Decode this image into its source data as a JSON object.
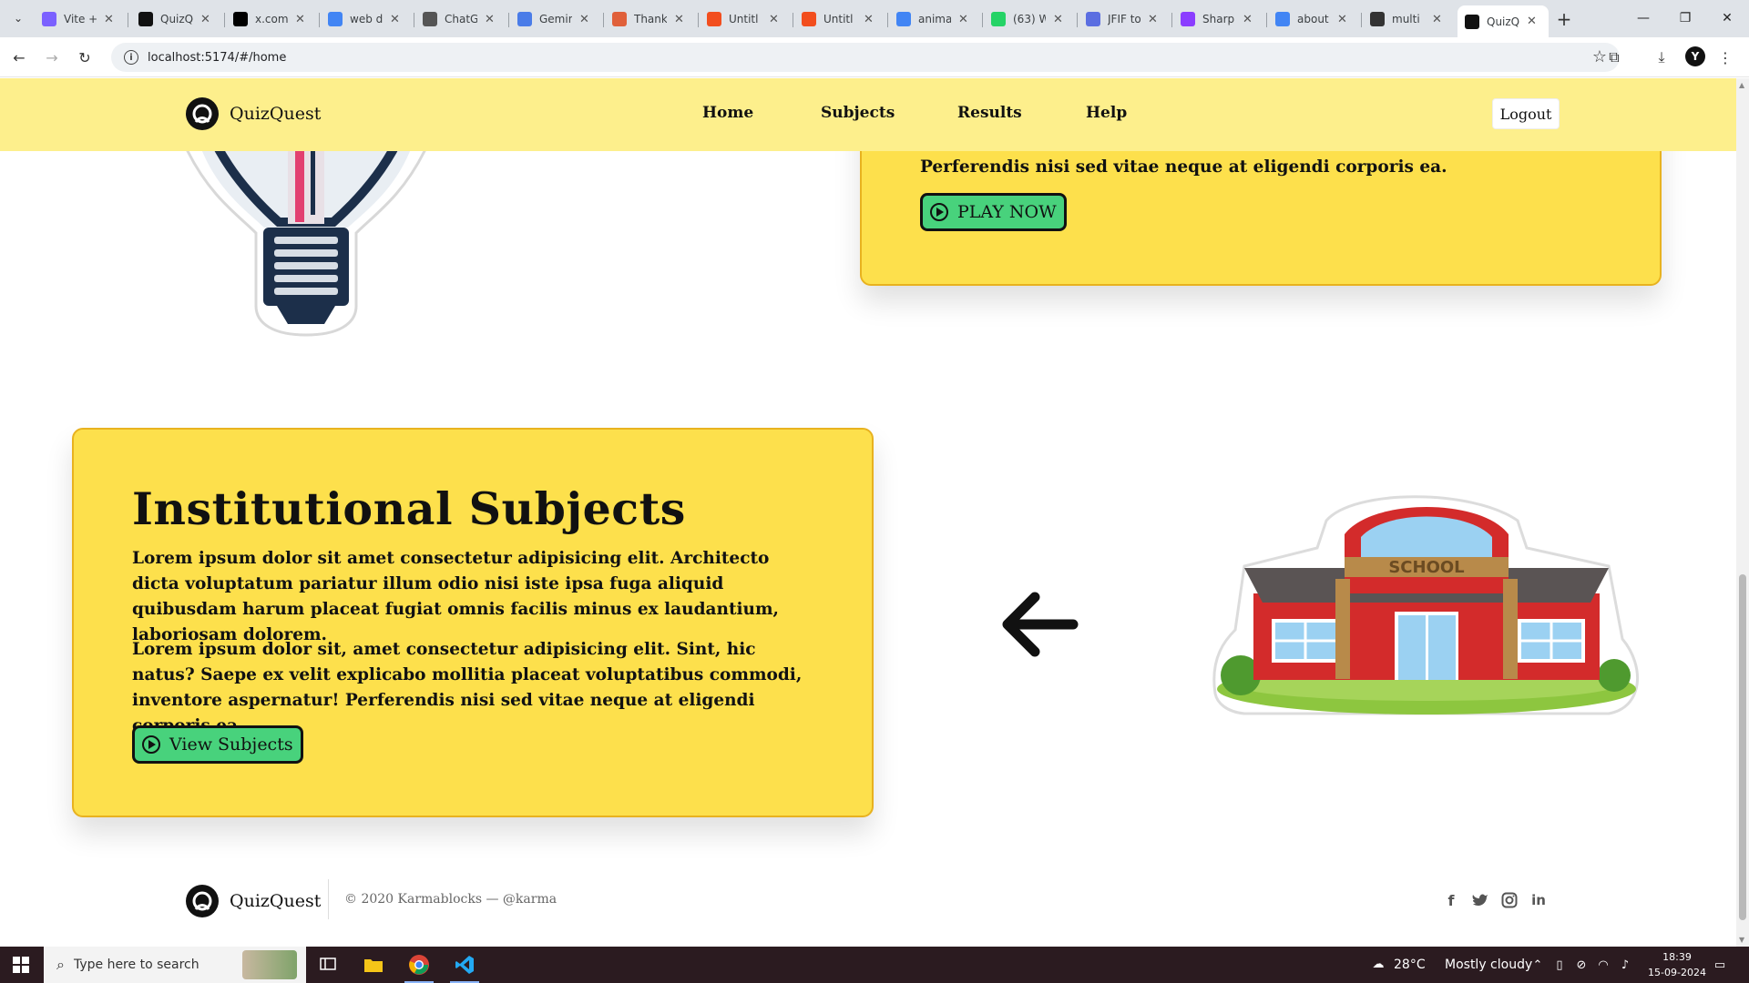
{
  "browser": {
    "tabs": [
      {
        "title": "Vite +",
        "color": "#7b61ff"
      },
      {
        "title": "QuizQ",
        "color": "#111111"
      },
      {
        "title": "x.com",
        "color": "#000000"
      },
      {
        "title": "web d",
        "color": "#4285f4"
      },
      {
        "title": "ChatG",
        "color": "#555555"
      },
      {
        "title": "Gemin",
        "color": "#4a7ce8"
      },
      {
        "title": "Thank",
        "color": "#e0603a"
      },
      {
        "title": "Untitl",
        "color": "#f24e1e"
      },
      {
        "title": "Untitl",
        "color": "#f24e1e"
      },
      {
        "title": "anima",
        "color": "#4285f4"
      },
      {
        "title": "(63) W",
        "color": "#25d366"
      },
      {
        "title": "JFIF to",
        "color": "#5b6ee1"
      },
      {
        "title": "Sharp",
        "color": "#8b3dff"
      },
      {
        "title": "about",
        "color": "#4285f4"
      },
      {
        "title": "multi",
        "color": "#333333"
      },
      {
        "title": "QuizQ",
        "color": "#111111"
      }
    ],
    "url": "localhost:5174/#/home"
  },
  "site": {
    "brand": "QuizQuest",
    "nav": [
      "Home",
      "Subjects",
      "Results",
      "Help"
    ],
    "logout": "Logout"
  },
  "top_card": {
    "partial_line": "Perferendis nisi sed vitae neque at eligendi corporis ea.",
    "button": "PLAY NOW"
  },
  "subjects_card": {
    "title": "Institutional Subjects",
    "paragraph1": "Lorem ipsum dolor sit amet consectetur adipisicing elit. Architecto dicta voluptatum pariatur illum odio nisi iste ipsa fuga aliquid quibusdam harum placeat fugiat omnis facilis minus ex laudantium, laboriosam dolorem.",
    "paragraph2": "Lorem ipsum dolor sit, amet consectetur adipisicing elit. Sint, hic natus? Saepe ex velit explicabo mollitia placeat voluptatibus commodi, inventore aspernatur! Perferendis nisi sed vitae neque at eligendi corporis ea.",
    "button": "View Subjects",
    "school_sign": "SCHOOL"
  },
  "footer": {
    "brand": "QuizQuest",
    "copyright": "© 2020 Karmablocks — @karma",
    "social": [
      "facebook-icon",
      "twitter-icon",
      "instagram-icon",
      "linkedin-icon"
    ]
  },
  "taskbar": {
    "search_placeholder": "Type here to search",
    "weather_temp": "28°C",
    "weather_desc": "Mostly cloudy",
    "time": "18:39",
    "date": "15-09-2024"
  }
}
